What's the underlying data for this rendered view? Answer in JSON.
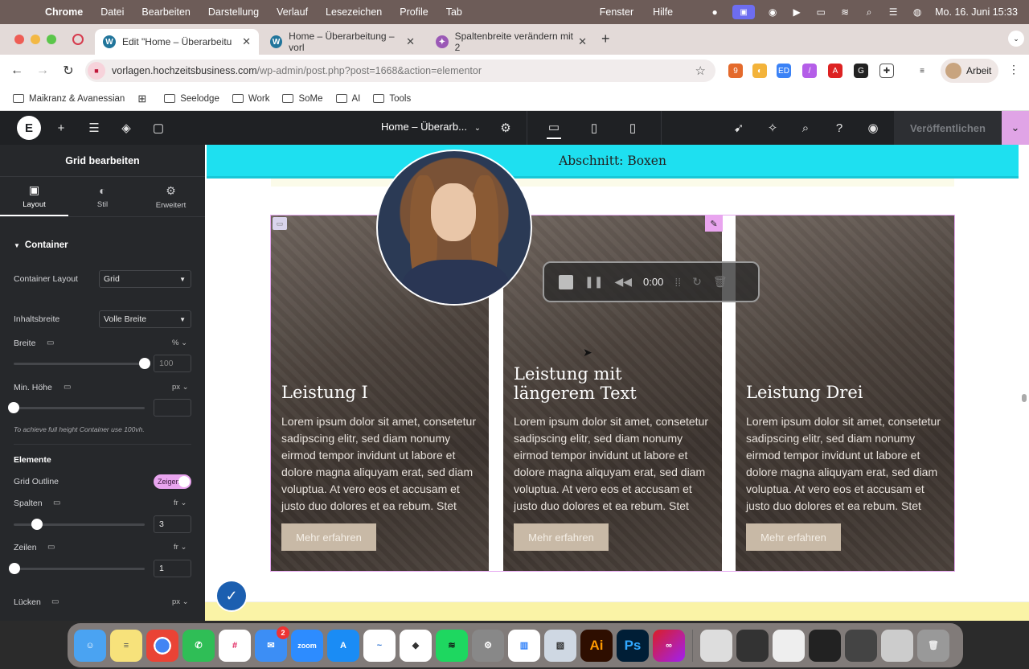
{
  "menubar": {
    "app": "Chrome",
    "items": [
      "Datei",
      "Bearbeiten",
      "Darstellung",
      "Verlauf",
      "Lesezeichen",
      "Profile",
      "Tab"
    ],
    "right_items": [
      "Fenster",
      "Hilfe"
    ],
    "datetime": "Mo. 16. Juni 15:33"
  },
  "tabs": [
    {
      "title": "Edit \"Home – Überarbeitu",
      "active": true
    },
    {
      "title": "Home – Überarbeitung – vorl",
      "active": false
    },
    {
      "title": "Spaltenbreite verändern mit 2",
      "active": false
    }
  ],
  "address": {
    "domain": "vorlagen.hochzeitsbusiness.com",
    "path": "/wp-admin/post.php?post=1668&action=elementor"
  },
  "profile": {
    "label": "Arbeit"
  },
  "bookmarks": [
    "Maikranz & Avanessian",
    "Seelodge",
    "Work",
    "SoMe",
    "AI",
    "Tools"
  ],
  "elementor": {
    "page_title": "Home – Überarb...",
    "publish_label": "Veröffentlichen"
  },
  "panel": {
    "title": "Grid bearbeiten",
    "tabs": [
      {
        "label": "Layout",
        "icon": "layout-icon"
      },
      {
        "label": "Stil",
        "icon": "style-icon"
      },
      {
        "label": "Erweitert",
        "icon": "gear-icon"
      }
    ],
    "section_container": "Container",
    "container_layout_label": "Container Layout",
    "container_layout_value": "Grid",
    "content_width_label": "Inhaltsbreite",
    "content_width_value": "Volle Breite",
    "width_label": "Breite",
    "width_unit": "%",
    "width_value": "100",
    "width_level": 1.0,
    "min_height_label": "Min. Höhe",
    "min_height_unit": "px",
    "min_height_value": "",
    "min_height_level": 0.0,
    "hint": "To achieve full height Container use 100vh.",
    "section_elements": "Elemente",
    "grid_outline_label": "Grid Outline",
    "grid_outline_value": "Zeigen",
    "columns_label": "Spalten",
    "columns_unit": "fr",
    "columns_value": "3",
    "rows_label": "Zeilen",
    "rows_unit": "fr",
    "rows_value": "1",
    "gaps_label": "Lücken",
    "gaps_unit": "px"
  },
  "canvas": {
    "section_label": "Abschnitt: Boxen",
    "cards": [
      {
        "title": "Leistung I",
        "text": "Lorem ipsum dolor sit amet, consetetur sadipscing elitr, sed diam nonumy eirmod tempor invidunt ut labore et dolore magna aliquyam erat, sed diam voluptua. At vero eos et accusam et justo duo dolores et ea rebum. Stet",
        "button": "Mehr erfahren"
      },
      {
        "title": "Leistung mit längerem Text",
        "text": "Lorem ipsum dolor sit amet, consetetur sadipscing elitr, sed diam nonumy eirmod tempor invidunt ut labore et dolore magna aliquyam erat, sed diam voluptua. At vero eos et accusam et justo duo dolores et ea rebum. Stet",
        "button": "Mehr erfahren"
      },
      {
        "title": "Leistung Drei",
        "text": "Lorem ipsum dolor sit amet, consetetur sadipscing elitr, sed diam nonumy eirmod tempor invidunt ut labore et dolore magna aliquyam erat, sed diam voluptua. At vero eos et accusam et justo duo dolores et ea rebum. Stet",
        "button": "Mehr erfahren"
      }
    ]
  },
  "recorder": {
    "time": "0:00"
  },
  "dock": {
    "apps": [
      "Finder",
      "Notes",
      "Chrome",
      "WhatsApp",
      "Slack",
      "Mail",
      "zoom",
      "App Store",
      "Freeform",
      "Notion",
      "Spotify",
      "Settings",
      "Files",
      "Preview",
      "Ai",
      "Ps",
      "Creative Cloud"
    ],
    "mail_badge": "2"
  },
  "colors": {
    "elementor_dark": "#1f2124",
    "accent_pink": "#e9a5ef",
    "section_cyan": "#1ee0f0",
    "button_beige": "#c8b9a6"
  }
}
